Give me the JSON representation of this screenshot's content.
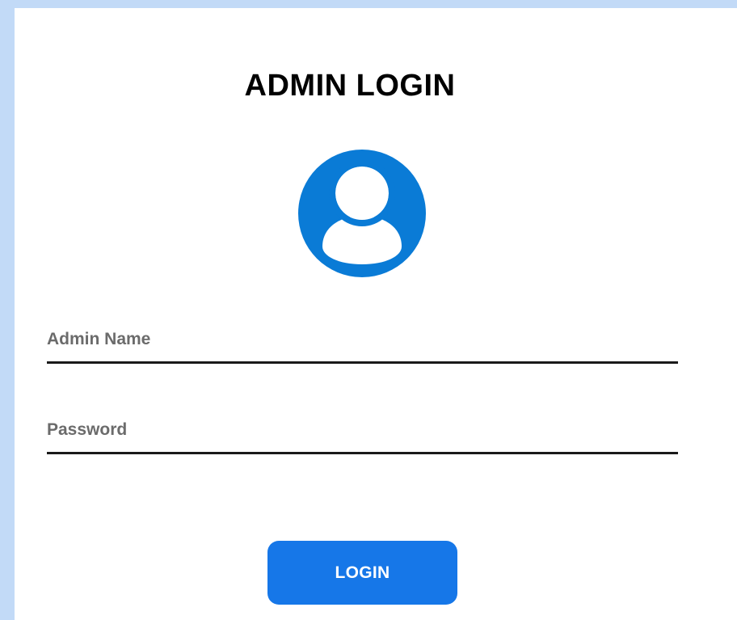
{
  "login": {
    "title": "ADMIN LOGIN",
    "avatar_icon": "user-circle-icon",
    "accent_color": "#0a7bd6",
    "admin_name": {
      "value": "",
      "placeholder": "Admin Name"
    },
    "password": {
      "value": "",
      "placeholder": "Password"
    },
    "button_label": "LOGIN",
    "button_color": "#1677e8"
  }
}
